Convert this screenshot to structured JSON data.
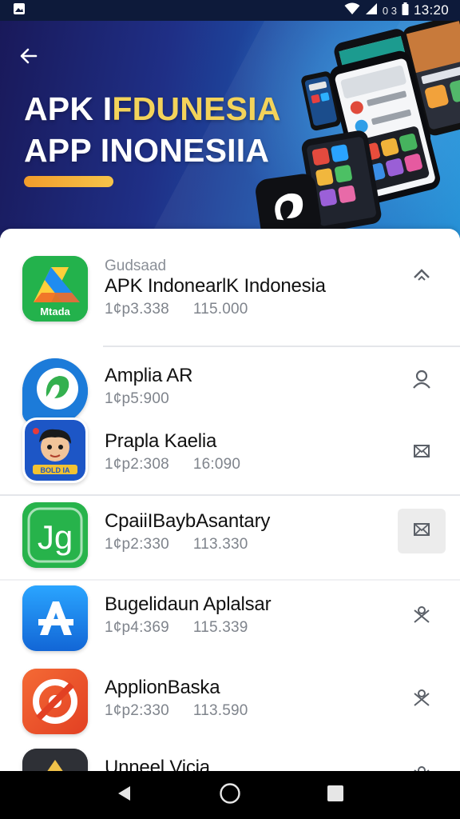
{
  "status_bar": {
    "network": "0 3",
    "time": "13:20"
  },
  "header": {
    "title_line1_part1": "APK I",
    "title_line1_part2": "FDUNESIA",
    "title_line2": "APP INONESIIA",
    "accent_color": "#f3d35a",
    "back_icon": "arrow-left-icon"
  },
  "apps": [
    {
      "category": "Gudsaad",
      "name": "APK IndonearlK Indonesia",
      "meta1": "1¢p3.338",
      "meta2": "115.000",
      "icon_label": "Mtada",
      "action_icon": "chevron-up-icon",
      "colors": {
        "bg": "#22b04b"
      }
    },
    {
      "category": "",
      "name": "Amplia AR",
      "meta1": "1¢p5:900",
      "meta2": "",
      "icon_label": "",
      "action_icon": "person-icon",
      "colors": {
        "bg": "#1c7bd9"
      }
    },
    {
      "category": "",
      "name": "Prapla Kaelia",
      "meta1": "1¢p2:308",
      "meta2": "16:090",
      "icon_label": "BOLD IA",
      "action_icon": "mail-icon",
      "colors": {
        "bg": "#1d56c6"
      }
    },
    {
      "category": "",
      "name": "CpaiiIBaybAsantary",
      "meta1": "1¢p2:330",
      "meta2": "113.330",
      "icon_label": "Jg",
      "action_icon": "mail-icon",
      "selected": true,
      "colors": {
        "bg": "#25b24a"
      }
    },
    {
      "category": "",
      "name": "Bugelidaun Aplalsar",
      "meta1": "1¢p4:369",
      "meta2": "115.339",
      "icon_label": "",
      "action_icon": "tools-icon",
      "colors": {
        "bg": "#1e8ef0"
      }
    },
    {
      "category": "",
      "name": "ApplionBaska",
      "meta1": "1¢p2:330",
      "meta2": "113.590",
      "icon_label": "",
      "action_icon": "tools-icon",
      "colors": {
        "bg": "#ef5a2c"
      }
    },
    {
      "category": "",
      "name": "Unneel Vicia",
      "meta1": "",
      "meta2": "",
      "icon_label": "",
      "action_icon": "tools-icon",
      "colors": {
        "bg": "#303238"
      }
    }
  ],
  "nav": {
    "back_icon": "triangle-back-icon",
    "home_icon": "circle-home-icon",
    "recents_icon": "square-recents-icon"
  }
}
